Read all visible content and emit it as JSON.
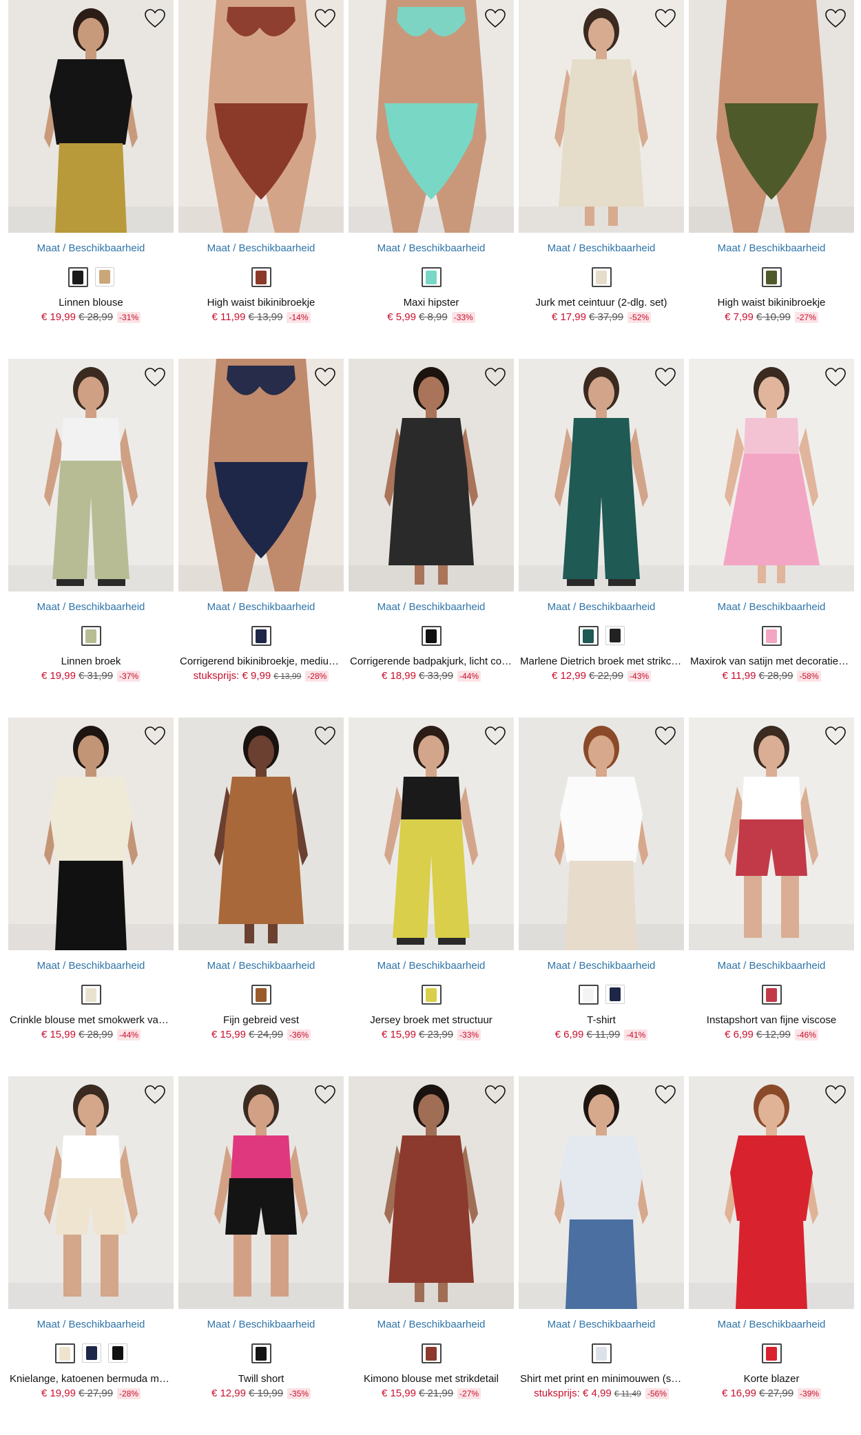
{
  "availability_label": "Maat / Beschikbaarheid",
  "colors": {
    "link": "#2f74a8",
    "sale": "#c8102e",
    "badge_bg": "#fbe3e6"
  },
  "products": [
    {
      "name": "Linnen blouse",
      "price_prefix": "",
      "price": "€ 19,99",
      "old_price": "€ 28,99",
      "discount": "-31%",
      "swatches": [
        "#1a1a1a",
        "#c9a77a"
      ],
      "model": {
        "bg": "#e9e6e2",
        "skin": "#c89a7c",
        "hair": "#2b1d16",
        "top": "#141414",
        "bottom": "#b89a3a",
        "kind": "top"
      }
    },
    {
      "name": "High waist bikinibroekje",
      "price_prefix": "",
      "price": "€ 11,99",
      "old_price": "€ 13,99",
      "discount": "-14%",
      "swatches": [
        "#8b3a2a"
      ],
      "model": {
        "bg": "#ede7e1",
        "skin": "#d4a488",
        "hair": "#3a2419",
        "top": "#8b3a2a",
        "bottom": "#8b3a2a",
        "kind": "bikini"
      }
    },
    {
      "name": "Maxi hipster",
      "price_prefix": "",
      "price": "€ 5,99",
      "old_price": "€ 8,99",
      "discount": "-33%",
      "swatches": [
        "#79d7c6"
      ],
      "model": {
        "bg": "#ebe8e4",
        "skin": "#c9987b",
        "hair": "#2b1d16",
        "top": "#79d7c6",
        "bottom": "#79d7c6",
        "kind": "bikini"
      }
    },
    {
      "name": "Jurk met ceintuur (2-dlg. set)",
      "price_prefix": "",
      "price": "€ 17,99",
      "old_price": "€ 37,99",
      "discount": "-52%",
      "swatches": [
        "#e5dcc9"
      ],
      "model": {
        "bg": "#eeebe7",
        "skin": "#d7ab90",
        "hair": "#3a2a20",
        "top": "#e5dcc9",
        "bottom": "#e5dcc9",
        "kind": "dress"
      }
    },
    {
      "name": "High waist bikinibroekje",
      "price_prefix": "",
      "price": "€ 7,99",
      "old_price": "€ 10,99",
      "discount": "-27%",
      "swatches": [
        "#4f5a2a"
      ],
      "model": {
        "bg": "#e7e3de",
        "skin": "#c99275",
        "hair": "#2b1d16",
        "top": "#c99275",
        "bottom": "#4f5a2a",
        "kind": "bikini"
      }
    },
    {
      "name": "Linnen broek",
      "price_prefix": "",
      "price": "€ 19,99",
      "old_price": "€ 31,99",
      "discount": "-37%",
      "swatches": [
        "#b8bc95"
      ],
      "model": {
        "bg": "#ecebe8",
        "skin": "#d0a084",
        "hair": "#3a2a20",
        "top": "#f2f2f2",
        "bottom": "#b8bc95",
        "kind": "pants"
      }
    },
    {
      "name": "Corrigerend bikinibroekje, medium...",
      "price_prefix": "stuksprijs:",
      "price": "€ 9,99",
      "old_price": "€ 13,99",
      "discount": "-28%",
      "swatches": [
        "#1e2748"
      ],
      "model": {
        "bg": "#ede7e1",
        "skin": "#c08a6c",
        "hair": "#2b1d16",
        "top": "#1e2748",
        "bottom": "#1e2748",
        "kind": "bikini"
      }
    },
    {
      "name": "Corrigerende badpakjurk, licht cor...",
      "price_prefix": "",
      "price": "€ 18,99",
      "old_price": "€ 33,99",
      "discount": "-44%",
      "swatches": [
        "#111111"
      ],
      "model": {
        "bg": "#e6e3df",
        "skin": "#a9745a",
        "hair": "#1c130e",
        "top": "#2a2a2a",
        "bottom": "#111111",
        "kind": "dress"
      }
    },
    {
      "name": "Marlene Dietrich broek met strikce...",
      "price_prefix": "",
      "price": "€ 12,99",
      "old_price": "€ 22,99",
      "discount": "-43%",
      "swatches": [
        "#1f5a55",
        "#222222"
      ],
      "model": {
        "bg": "#eceae6",
        "skin": "#d2a48a",
        "hair": "#3a2a20",
        "top": "#1f5a55",
        "bottom": "#1f5a55",
        "kind": "pants"
      }
    },
    {
      "name": "Maxirok van satijn met decoratieve ...",
      "price_prefix": "",
      "price": "€ 11,99",
      "old_price": "€ 28,99",
      "discount": "-58%",
      "swatches": [
        "#f3a6c4"
      ],
      "model": {
        "bg": "#f0eeeb",
        "skin": "#e0b59c",
        "hair": "#3a2a20",
        "top": "#f3c3d4",
        "bottom": "#f3a6c4",
        "kind": "skirt"
      }
    },
    {
      "name": "Crinkle blouse met smokwerk van s...",
      "price_prefix": "",
      "price": "€ 15,99",
      "old_price": "€ 28,99",
      "discount": "-44%",
      "swatches": [
        "#e8e2cf"
      ],
      "model": {
        "bg": "#ebe8e4",
        "skin": "#c39577",
        "hair": "#1f1510",
        "top": "#efe9d8",
        "bottom": "#111111",
        "kind": "top"
      }
    },
    {
      "name": "Fijn gebreid vest",
      "price_prefix": "",
      "price": "€ 15,99",
      "old_price": "€ 24,99",
      "discount": "-36%",
      "swatches": [
        "#9a5a2c"
      ],
      "model": {
        "bg": "#e5e3df",
        "skin": "#6b4030",
        "hair": "#1a120e",
        "top": "#a8683a",
        "bottom": "#9a5a2c",
        "kind": "dress"
      }
    },
    {
      "name": "Jersey broek met structuur",
      "price_prefix": "",
      "price": "€ 15,99",
      "old_price": "€ 23,99",
      "discount": "-33%",
      "swatches": [
        "#d9cf4a"
      ],
      "model": {
        "bg": "#eceae7",
        "skin": "#d3a68c",
        "hair": "#2b1d16",
        "top": "#1a1a1a",
        "bottom": "#d9cf4a",
        "kind": "pants"
      }
    },
    {
      "name": "T-shirt",
      "price_prefix": "",
      "price": "€ 6,99",
      "old_price": "€ 11,99",
      "discount": "-41%",
      "swatches": [
        "#f4f4f4",
        "#1e2748"
      ],
      "model": {
        "bg": "#e9e7e3",
        "skin": "#d7a88c",
        "hair": "#8a4a2a",
        "top": "#fbfbfb",
        "bottom": "#e7dccb",
        "kind": "top"
      }
    },
    {
      "name": "Instapshort van fijne viscose",
      "price_prefix": "",
      "price": "€ 6,99",
      "old_price": "€ 12,99",
      "discount": "-46%",
      "swatches": [
        "#c23a48"
      ],
      "model": {
        "bg": "#efedea",
        "skin": "#d9ae94",
        "hair": "#3a2a20",
        "top": "#ffffff",
        "bottom": "#c23a48",
        "kind": "shorts"
      }
    },
    {
      "name": "Knielange, katoenen bermuda met ...",
      "price_prefix": "",
      "price": "€ 19,99",
      "old_price": "€ 27,99",
      "discount": "-28%",
      "swatches": [
        "#efe4cf",
        "#1e2748",
        "#111111"
      ],
      "model": {
        "bg": "#ebe9e6",
        "skin": "#d4a68a",
        "hair": "#3a2a20",
        "top": "#ffffff",
        "bottom": "#efe4cf",
        "kind": "shorts"
      }
    },
    {
      "name": "Twill short",
      "price_prefix": "",
      "price": "€ 12,99",
      "old_price": "€ 19,99",
      "discount": "-35%",
      "swatches": [
        "#141414"
      ],
      "model": {
        "bg": "#e8e6e3",
        "skin": "#d2a185",
        "hair": "#3a2a20",
        "top": "#e0387f",
        "bottom": "#141414",
        "kind": "shorts"
      }
    },
    {
      "name": "Kimono blouse met strikdetail",
      "price_prefix": "",
      "price": "€ 15,99",
      "old_price": "€ 21,99",
      "discount": "-27%",
      "swatches": [
        "#8c3a2e"
      ],
      "model": {
        "bg": "#e6e3df",
        "skin": "#a06e55",
        "hair": "#1a120e",
        "top": "#8c3a2e",
        "bottom": "#8c3a2e",
        "kind": "dress"
      }
    },
    {
      "name": "Shirt met print en minimouwen (se...",
      "price_prefix": "stuksprijs:",
      "price": "€ 4,99",
      "old_price": "€ 11,49",
      "discount": "-56%",
      "swatches": [
        "#dde2ea"
      ],
      "model": {
        "bg": "#eceae7",
        "skin": "#d6a88c",
        "hair": "#1f1510",
        "top": "#e4e8ef",
        "bottom": "#4a6fa0",
        "kind": "top"
      }
    },
    {
      "name": "Korte blazer",
      "price_prefix": "",
      "price": "€ 16,99",
      "old_price": "€ 27,99",
      "discount": "-39%",
      "swatches": [
        "#d8232e"
      ],
      "model": {
        "bg": "#ebe9e6",
        "skin": "#e0b296",
        "hair": "#8a4a2a",
        "top": "#d8232e",
        "bottom": "#d8232e",
        "kind": "top"
      }
    }
  ]
}
